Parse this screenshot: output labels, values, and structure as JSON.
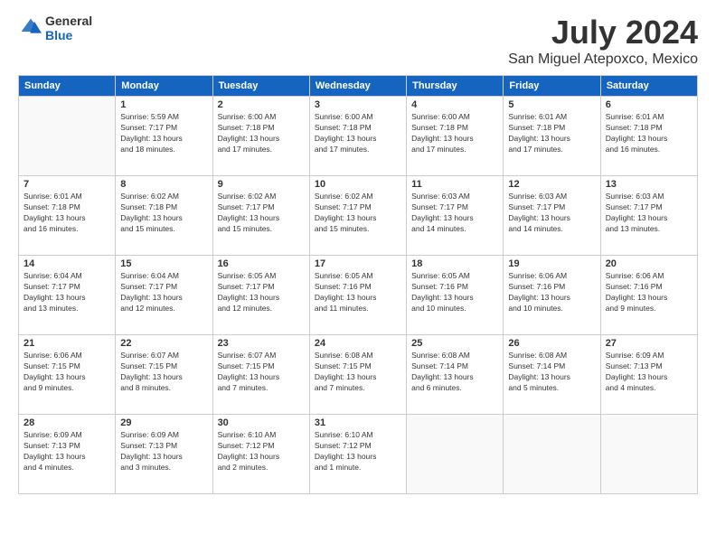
{
  "header": {
    "logo_general": "General",
    "logo_blue": "Blue",
    "month_year": "July 2024",
    "location": "San Miguel Atepoxco, Mexico"
  },
  "weekdays": [
    "Sunday",
    "Monday",
    "Tuesday",
    "Wednesday",
    "Thursday",
    "Friday",
    "Saturday"
  ],
  "weeks": [
    [
      {
        "day": "",
        "info": ""
      },
      {
        "day": "1",
        "info": "Sunrise: 5:59 AM\nSunset: 7:17 PM\nDaylight: 13 hours\nand 18 minutes."
      },
      {
        "day": "2",
        "info": "Sunrise: 6:00 AM\nSunset: 7:18 PM\nDaylight: 13 hours\nand 17 minutes."
      },
      {
        "day": "3",
        "info": "Sunrise: 6:00 AM\nSunset: 7:18 PM\nDaylight: 13 hours\nand 17 minutes."
      },
      {
        "day": "4",
        "info": "Sunrise: 6:00 AM\nSunset: 7:18 PM\nDaylight: 13 hours\nand 17 minutes."
      },
      {
        "day": "5",
        "info": "Sunrise: 6:01 AM\nSunset: 7:18 PM\nDaylight: 13 hours\nand 17 minutes."
      },
      {
        "day": "6",
        "info": "Sunrise: 6:01 AM\nSunset: 7:18 PM\nDaylight: 13 hours\nand 16 minutes."
      }
    ],
    [
      {
        "day": "7",
        "info": "Sunrise: 6:01 AM\nSunset: 7:18 PM\nDaylight: 13 hours\nand 16 minutes."
      },
      {
        "day": "8",
        "info": "Sunrise: 6:02 AM\nSunset: 7:18 PM\nDaylight: 13 hours\nand 15 minutes."
      },
      {
        "day": "9",
        "info": "Sunrise: 6:02 AM\nSunset: 7:17 PM\nDaylight: 13 hours\nand 15 minutes."
      },
      {
        "day": "10",
        "info": "Sunrise: 6:02 AM\nSunset: 7:17 PM\nDaylight: 13 hours\nand 15 minutes."
      },
      {
        "day": "11",
        "info": "Sunrise: 6:03 AM\nSunset: 7:17 PM\nDaylight: 13 hours\nand 14 minutes."
      },
      {
        "day": "12",
        "info": "Sunrise: 6:03 AM\nSunset: 7:17 PM\nDaylight: 13 hours\nand 14 minutes."
      },
      {
        "day": "13",
        "info": "Sunrise: 6:03 AM\nSunset: 7:17 PM\nDaylight: 13 hours\nand 13 minutes."
      }
    ],
    [
      {
        "day": "14",
        "info": "Sunrise: 6:04 AM\nSunset: 7:17 PM\nDaylight: 13 hours\nand 13 minutes."
      },
      {
        "day": "15",
        "info": "Sunrise: 6:04 AM\nSunset: 7:17 PM\nDaylight: 13 hours\nand 12 minutes."
      },
      {
        "day": "16",
        "info": "Sunrise: 6:05 AM\nSunset: 7:17 PM\nDaylight: 13 hours\nand 12 minutes."
      },
      {
        "day": "17",
        "info": "Sunrise: 6:05 AM\nSunset: 7:16 PM\nDaylight: 13 hours\nand 11 minutes."
      },
      {
        "day": "18",
        "info": "Sunrise: 6:05 AM\nSunset: 7:16 PM\nDaylight: 13 hours\nand 10 minutes."
      },
      {
        "day": "19",
        "info": "Sunrise: 6:06 AM\nSunset: 7:16 PM\nDaylight: 13 hours\nand 10 minutes."
      },
      {
        "day": "20",
        "info": "Sunrise: 6:06 AM\nSunset: 7:16 PM\nDaylight: 13 hours\nand 9 minutes."
      }
    ],
    [
      {
        "day": "21",
        "info": "Sunrise: 6:06 AM\nSunset: 7:15 PM\nDaylight: 13 hours\nand 9 minutes."
      },
      {
        "day": "22",
        "info": "Sunrise: 6:07 AM\nSunset: 7:15 PM\nDaylight: 13 hours\nand 8 minutes."
      },
      {
        "day": "23",
        "info": "Sunrise: 6:07 AM\nSunset: 7:15 PM\nDaylight: 13 hours\nand 7 minutes."
      },
      {
        "day": "24",
        "info": "Sunrise: 6:08 AM\nSunset: 7:15 PM\nDaylight: 13 hours\nand 7 minutes."
      },
      {
        "day": "25",
        "info": "Sunrise: 6:08 AM\nSunset: 7:14 PM\nDaylight: 13 hours\nand 6 minutes."
      },
      {
        "day": "26",
        "info": "Sunrise: 6:08 AM\nSunset: 7:14 PM\nDaylight: 13 hours\nand 5 minutes."
      },
      {
        "day": "27",
        "info": "Sunrise: 6:09 AM\nSunset: 7:13 PM\nDaylight: 13 hours\nand 4 minutes."
      }
    ],
    [
      {
        "day": "28",
        "info": "Sunrise: 6:09 AM\nSunset: 7:13 PM\nDaylight: 13 hours\nand 4 minutes."
      },
      {
        "day": "29",
        "info": "Sunrise: 6:09 AM\nSunset: 7:13 PM\nDaylight: 13 hours\nand 3 minutes."
      },
      {
        "day": "30",
        "info": "Sunrise: 6:10 AM\nSunset: 7:12 PM\nDaylight: 13 hours\nand 2 minutes."
      },
      {
        "day": "31",
        "info": "Sunrise: 6:10 AM\nSunset: 7:12 PM\nDaylight: 13 hours\nand 1 minute."
      },
      {
        "day": "",
        "info": ""
      },
      {
        "day": "",
        "info": ""
      },
      {
        "day": "",
        "info": ""
      }
    ]
  ]
}
